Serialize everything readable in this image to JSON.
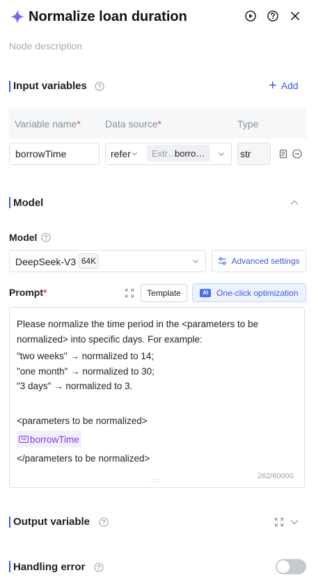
{
  "header": {
    "title": "Normalize loan duration",
    "description_placeholder": "Node description"
  },
  "input_variables": {
    "title": "Input variables",
    "add_label": "Add",
    "columns": {
      "name": "Variable name",
      "source": "Data source",
      "type": "Type"
    },
    "required_mark": "*",
    "rows": [
      {
        "name": "borrowTime",
        "source_mode": "refer",
        "source_node": "Extr…",
        "source_var": "borro…",
        "type": "str"
      }
    ]
  },
  "model_section": {
    "title": "Model",
    "model_label": "Model",
    "model_name": "DeepSeek-V3",
    "context_badge": "64K",
    "advanced_label": "Advanced settings",
    "prompt_label": "Prompt",
    "template_label": "Template",
    "ai_chip": "AI",
    "optimize_label": "One-click optimization",
    "prompt_lines": [
      "Please normalize the time period in the <parameters to be",
      "normalized> into specific days. For example:",
      "\"two weeks\" → normalized to 14;",
      "\"one month\" → normalized to 30;",
      "\"3 days\" → normalized to 3.",
      "<parameters to be normalized>",
      "</parameters to be normalized>"
    ],
    "var_chip_icon": "var",
    "prompt_variable": "borrowTime",
    "char_count": "262/60000",
    "drag_handle": "::::"
  },
  "output_section": {
    "title": "Output variable"
  },
  "error_section": {
    "title": "Handling error",
    "enabled": false
  },
  "colors": {
    "accent": "#3b5bdb",
    "brand_icon": "#7b61ff",
    "required": "#e5484d",
    "variable": "#7c3aed"
  }
}
